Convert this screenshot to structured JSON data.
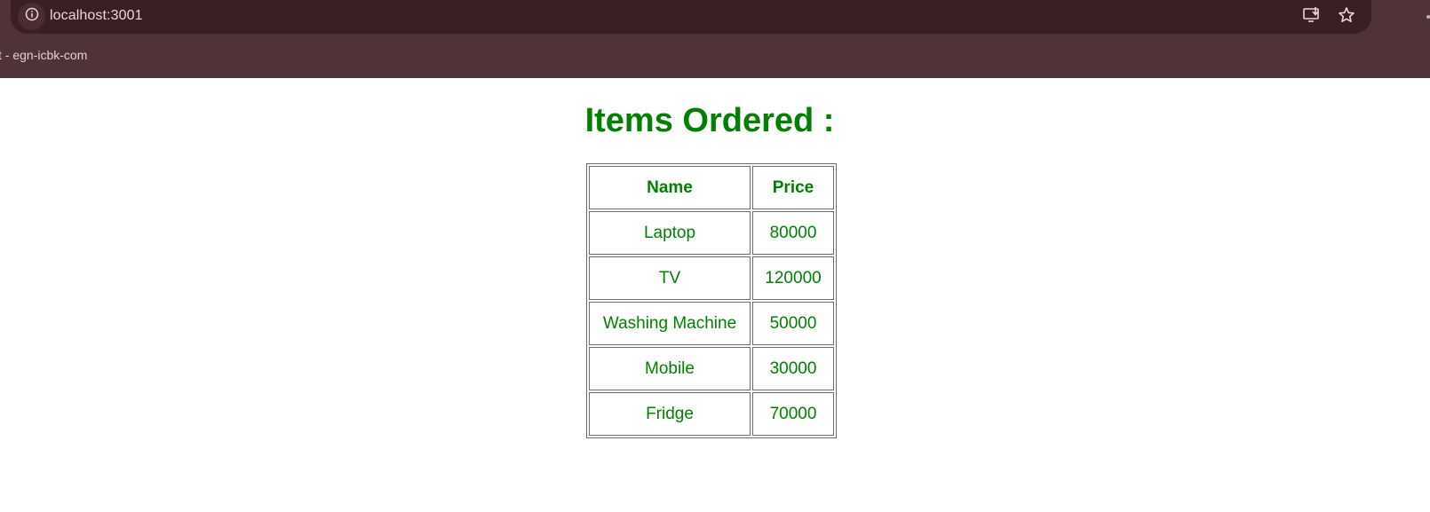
{
  "browser": {
    "url": "localhost:3001",
    "bookmark_label": "t - egn-icbk-com"
  },
  "page": {
    "title": "Items Ordered :",
    "table": {
      "headers": [
        "Name",
        "Price"
      ],
      "rows": [
        [
          "Laptop",
          "80000"
        ],
        [
          "TV",
          "120000"
        ],
        [
          "Washing Machine",
          "50000"
        ],
        [
          "Mobile",
          "30000"
        ],
        [
          "Fridge",
          "70000"
        ]
      ]
    }
  },
  "colors": {
    "accent": "#008000",
    "chrome_bg": "#4f3338",
    "address_bg": "#3a1f23"
  },
  "icons": [
    "info-icon",
    "install-app-icon",
    "star-icon"
  ]
}
